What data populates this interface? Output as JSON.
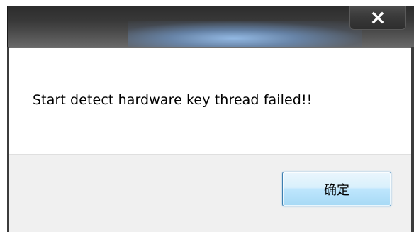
{
  "dialog": {
    "message": "Start detect hardware key thread failed!!",
    "ok_label": "确定",
    "close_label": "x"
  },
  "icons": {
    "close": "close-icon"
  },
  "colors": {
    "titlebar": "#383838",
    "content_background": "#ffffff",
    "footer_background": "#f0f0f0",
    "button_border": "#3c7fb1",
    "button_fill": "#bee6fd"
  }
}
